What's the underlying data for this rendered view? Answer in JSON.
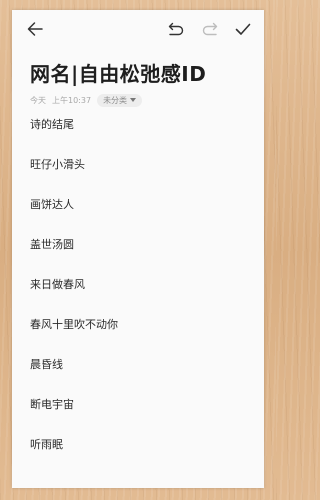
{
  "toolbar": {
    "back_icon": "arrow-left-icon",
    "undo_icon": "undo-icon",
    "redo_icon": "redo-icon",
    "done_icon": "checkmark-icon"
  },
  "note": {
    "title": "网名|自由松弛感ID",
    "date": "今天",
    "time": "上午10:37",
    "category": "未分类",
    "lines": [
      "诗的结尾",
      "旺仔小滑头",
      "画饼达人",
      "盖世汤圆",
      "来日做春风",
      "春风十里吹不动你",
      "晨昏线",
      "断电宇宙",
      "听雨眠"
    ]
  },
  "colors": {
    "background": "#deb68c",
    "paper": "#fafafa",
    "title_text": "#1e1e1e",
    "meta_text": "#a9a9a9",
    "redo_disabled": "#bdbdbd"
  }
}
